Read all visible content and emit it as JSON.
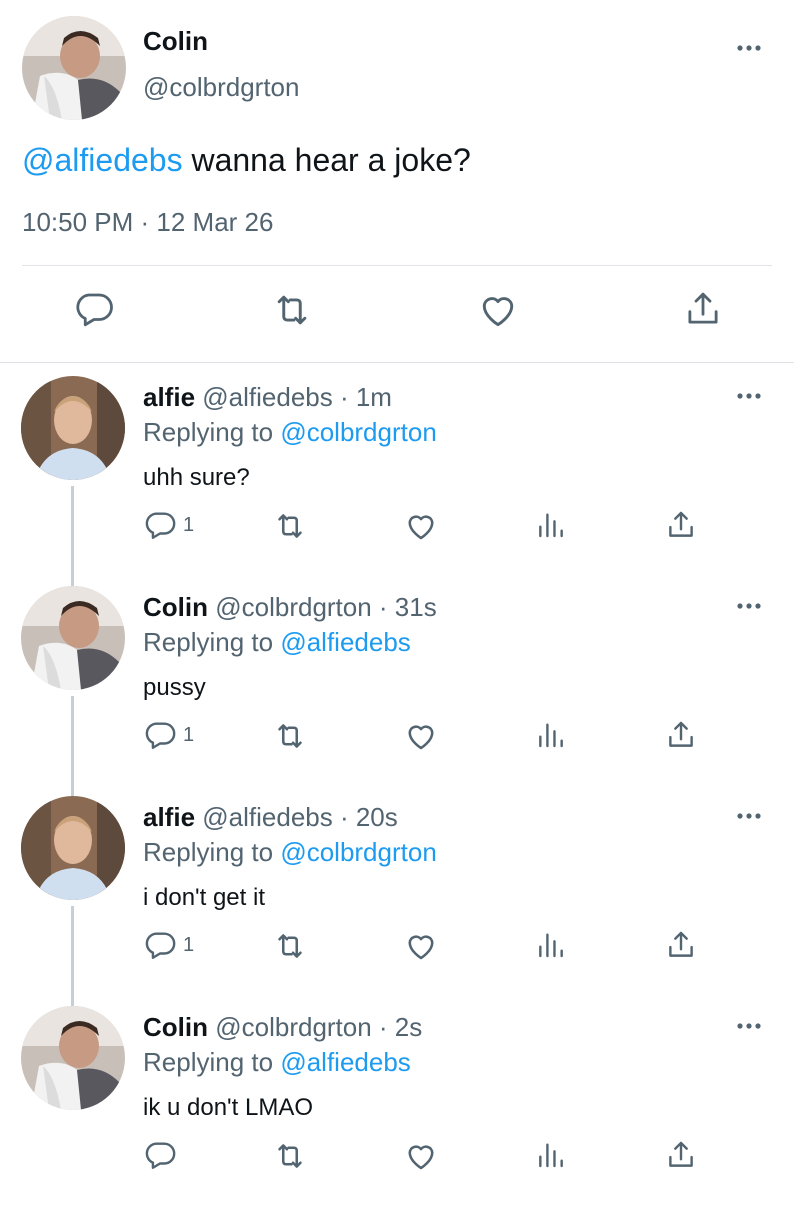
{
  "main_tweet": {
    "name": "Colin",
    "handle": "@colbrdgrton",
    "mention": "@alfiedebs",
    "text": " wanna hear a joke?",
    "timestamp": "10:50 PM · 12 Mar 26"
  },
  "replies": [
    {
      "name": "alfie",
      "handle": "@alfiedebs · 1m",
      "replying_prefix": "Replying to ",
      "replying_to": "@colbrdgrton",
      "text": "uhh sure?",
      "reply_count": "1"
    },
    {
      "name": "Colin",
      "handle": "@colbrdgrton · 31s",
      "replying_prefix": "Replying to ",
      "replying_to": "@alfiedebs",
      "text": "pussy",
      "reply_count": "1"
    },
    {
      "name": "alfie",
      "handle": "@alfiedebs · 20s",
      "replying_prefix": "Replying to ",
      "replying_to": "@colbrdgrton",
      "text": "i don't get it",
      "reply_count": "1"
    },
    {
      "name": "Colin",
      "handle": "@colbrdgrton · 2s",
      "replying_prefix": "Replying to ",
      "replying_to": "@alfiedebs",
      "text": "ik u don't LMAO",
      "reply_count": ""
    }
  ],
  "colors": {
    "accent": "#1d9bf0",
    "secondary_text": "#536471",
    "icon": "#536471"
  },
  "icons": [
    "reply-icon",
    "retweet-icon",
    "like-icon",
    "analytics-icon",
    "share-icon",
    "more-icon"
  ]
}
